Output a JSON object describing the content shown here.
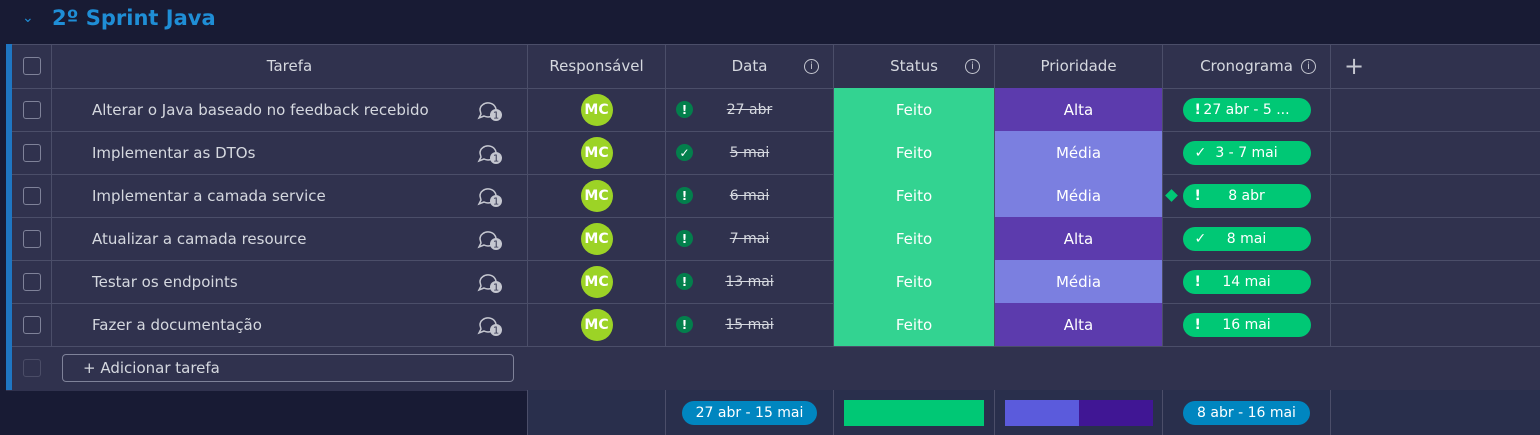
{
  "group": {
    "title": "2º Sprint Java",
    "collapse_icon": "chevron-down-icon",
    "color": "#1f8ed6"
  },
  "columns": {
    "task": "Tarefa",
    "owner": "Responsável",
    "date": "Data",
    "status": "Status",
    "priority": "Prioridade",
    "timeline": "Cronograma",
    "add_column": "+"
  },
  "info_glyph": "i",
  "rows": [
    {
      "task": "Alterar o Java baseado no feedback recebido",
      "updates": "1",
      "owner": "MC",
      "date": "27 abr",
      "date_icon": "!",
      "status": "Feito",
      "priority": "Alta",
      "timeline": "27 abr - 5 ...",
      "timeline_icon": "!"
    },
    {
      "task": "Implementar as DTOs",
      "updates": "1",
      "owner": "MC",
      "date": "5 mai",
      "date_icon": "✓",
      "status": "Feito",
      "priority": "Média",
      "timeline": "3 - 7 mai",
      "timeline_icon": "✓"
    },
    {
      "task": "Implementar a camada service",
      "updates": "1",
      "owner": "MC",
      "date": "6 mai",
      "date_icon": "!",
      "status": "Feito",
      "priority": "Média",
      "timeline": "8 abr",
      "timeline_icon": "!"
    },
    {
      "task": "Atualizar a camada resource",
      "updates": "1",
      "owner": "MC",
      "date": "7 mai",
      "date_icon": "!",
      "status": "Feito",
      "priority": "Alta",
      "timeline": "8 mai",
      "timeline_icon": "✓"
    },
    {
      "task": "Testar os endpoints",
      "updates": "1",
      "owner": "MC",
      "date": "13 mai",
      "date_icon": "!",
      "status": "Feito",
      "priority": "Média",
      "timeline": "14 mai",
      "timeline_icon": "!"
    },
    {
      "task": "Fazer a documentação",
      "updates": "1",
      "owner": "MC",
      "date": "15 mai",
      "date_icon": "!",
      "status": "Feito",
      "priority": "Alta",
      "timeline": "16 mai",
      "timeline_icon": "!"
    }
  ],
  "add_task": "+ Adicionar tarefa",
  "summary": {
    "date_range": "27 abr - 15 mai",
    "timeline_range": "8 abr - 16 mai",
    "status_done_fraction": 1.0,
    "priority_media_fraction": 0.5,
    "priority_alta_fraction": 0.5
  },
  "colors": {
    "status_done": "#33d391",
    "priority_alta": "#5c3bad",
    "priority_media": "#7b7fe0",
    "timeline_green": "#00c875",
    "avatar": "#9cd326",
    "group_accent": "#1f76c2"
  }
}
